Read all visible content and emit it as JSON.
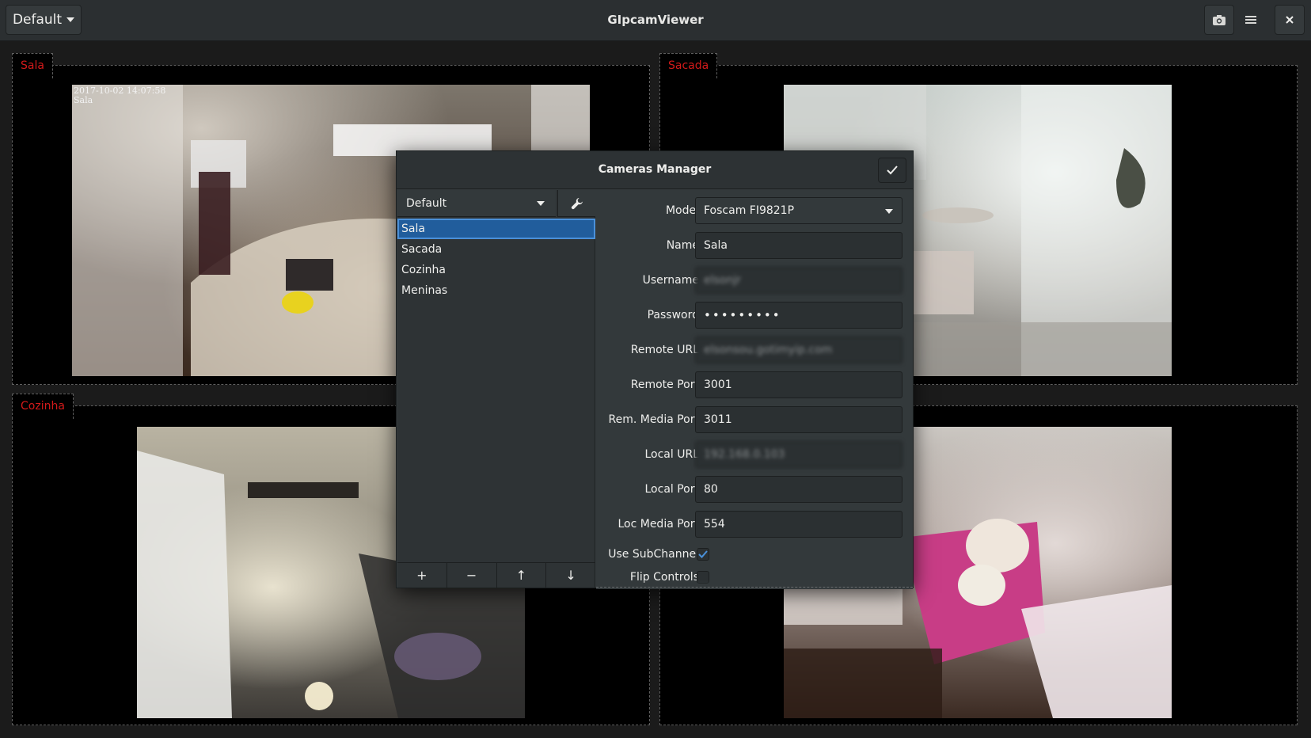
{
  "header": {
    "profile_label": "Default",
    "title": "GIpcamViewer",
    "snapshot_icon": "camera-icon",
    "menu_icon": "hamburger-menu-icon",
    "close_icon": "close-icon"
  },
  "cameras": [
    {
      "name": "Sala",
      "overlay_line1": "2017-10-02 14:07:58",
      "overlay_line2": "Sala"
    },
    {
      "name": "Sacada"
    },
    {
      "name": "Cozinha"
    },
    {
      "name": "Meninas"
    }
  ],
  "dialog": {
    "title": "Cameras Manager",
    "confirm_icon": "checkmark-icon",
    "profile_combo": "Default",
    "tools_icon": "wrench-icon",
    "camera_list": [
      "Sala",
      "Sacada",
      "Cozinha",
      "Meninas"
    ],
    "selected_camera": "Sala",
    "list_toolbar": {
      "add": "+",
      "remove": "−",
      "up": "↑",
      "down": "↓"
    },
    "form": {
      "model_label": "Model",
      "model_value": "Foscam FI9821P",
      "name_label": "Name",
      "name_value": "Sala",
      "username_label": "Username",
      "username_value": "elsonjr",
      "password_label": "Password",
      "password_value": "•••••••••",
      "remote_url_label": "Remote URL",
      "remote_url_value": "elsonsou.gotimyip.com",
      "remote_port_label": "Remote Port",
      "remote_port_value": "3001",
      "rem_media_port_label": "Rem. Media Port",
      "rem_media_port_value": "3011",
      "local_url_label": "Local URL",
      "local_url_value": "192.168.0.103",
      "local_port_label": "Local Port",
      "local_port_value": "80",
      "loc_media_port_label": "Loc Media Port",
      "loc_media_port_value": "554",
      "use_subchannel_label": "Use SubChannel",
      "use_subchannel_checked": true,
      "flip_controls_label": "Flip Controls",
      "flip_controls_checked": false
    }
  },
  "colors": {
    "accent": "#4a90d9",
    "camera_label": "#d41a1a",
    "selection": "#215d9c"
  }
}
